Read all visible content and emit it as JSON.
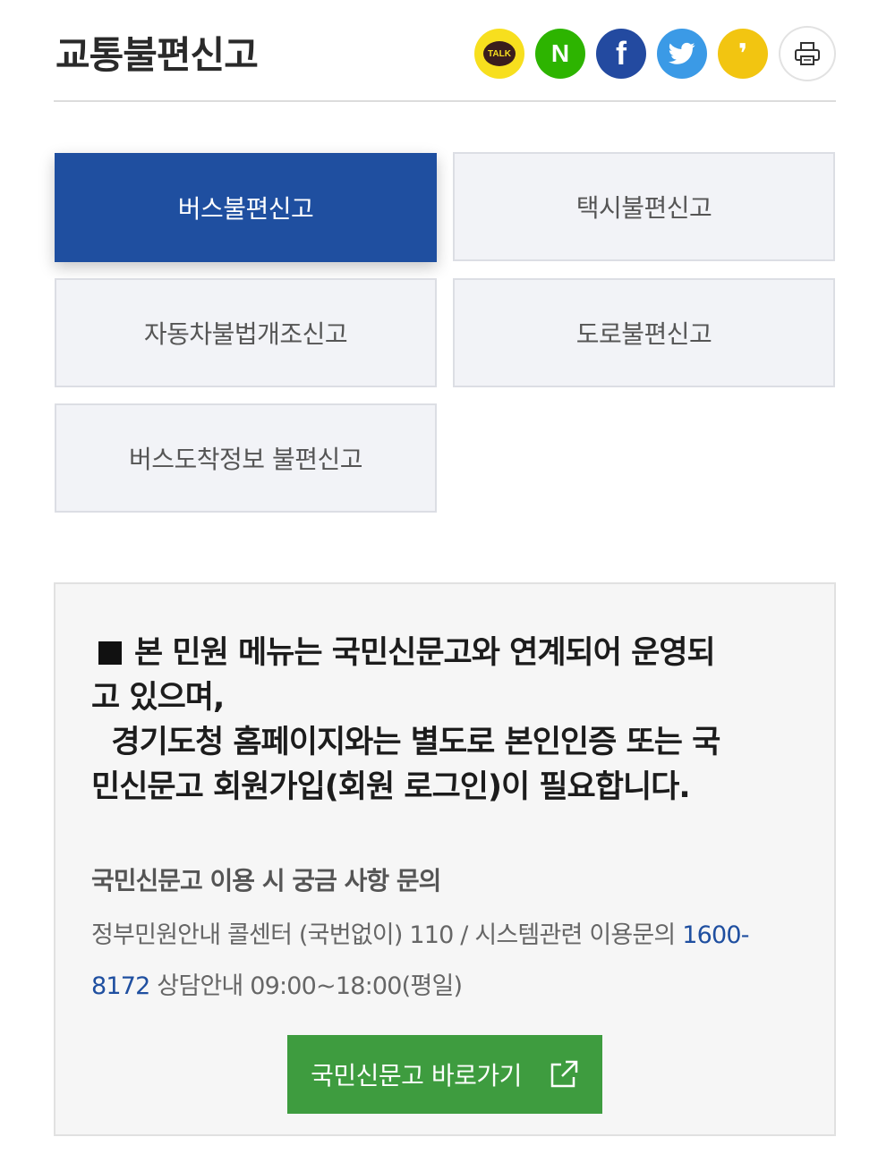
{
  "header": {
    "title": "교통불편신고",
    "share": {
      "kakaotalk_label": "TALK",
      "naver_label": "N",
      "facebook_label": "f",
      "kakaostory_label": "❜",
      "colors": {
        "kakaotalk": "#f7df1e",
        "naver": "#2db400",
        "facebook": "#234aa0",
        "twitter": "#3b9ae6",
        "kakaostory": "#f2c511"
      }
    }
  },
  "tabs": [
    {
      "label": "버스불편신고",
      "active": true
    },
    {
      "label": "택시불편신고",
      "active": false
    },
    {
      "label": "자동차불법개조신고",
      "active": false
    },
    {
      "label": "도로불편신고",
      "active": false
    },
    {
      "label": "버스도착정보 불편신고",
      "active": false
    }
  ],
  "notice": {
    "main_lines": [
      "본 민원 메뉴는 국민신문고와 연계되어 운영되",
      "고 있으며,",
      "  경기도청 홈페이지와는 별도로 본인인증 또는 국",
      "민신문고 회원가입(회원 로그인)이 필요합니다."
    ],
    "contact_title": "국민신문고 이용 시 궁금 사항 문의",
    "contact_line1": "정부민원안내 콜센터 (국번없이) 110 / 시스템관련 이용문의 ",
    "contact_phone_part1": "1600-",
    "contact_phone_part2": "8172",
    "contact_line2": " 상담안내 09:00~18:00(평일)",
    "go_button_label": "국민신문고 바로가기"
  },
  "colors": {
    "accent": "#1f4fa0",
    "button_green": "#3e9c3f"
  }
}
